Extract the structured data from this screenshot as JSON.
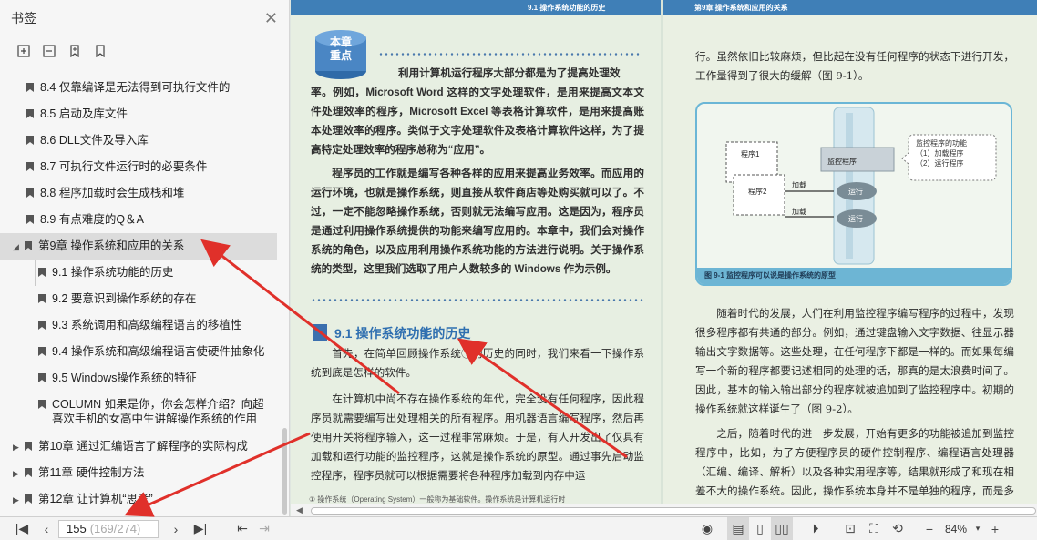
{
  "sidebar": {
    "title": "书签",
    "close": "✕",
    "items": [
      {
        "label": "8.4  仅靠编译是无法得到可执行文件的"
      },
      {
        "label": "8.5  启动及库文件"
      },
      {
        "label": "8.6  DLL文件及导入库"
      },
      {
        "label": "8.7  可执行文件运行时的必要条件"
      },
      {
        "label": "8.8  程序加载时会生成栈和堆"
      },
      {
        "label": "8.9  有点难度的Q＆A"
      },
      {
        "label": "第9章  操作系统和应用的关系"
      },
      {
        "label": "9.1  操作系统功能的历史"
      },
      {
        "label": "9.2  要意识到操作系统的存在"
      },
      {
        "label": "9.3  系统调用和高级编程语言的移植性"
      },
      {
        "label": "9.4  操作系统和高级编程语言使硬件抽象化"
      },
      {
        "label": "9.5  Windows操作系统的特征"
      },
      {
        "label": "COLUMN  如果是你，你会怎样介绍？向超喜欢手机的女高中生讲解操作系统的作用"
      },
      {
        "label": "第10章  通过汇编语言了解程序的实际构成"
      },
      {
        "label": "第11章  硬件控制方法"
      },
      {
        "label": "第12章  让计算机“思考”"
      }
    ]
  },
  "left_page": {
    "header": "9.1  操作系统功能的历史",
    "badge": "本章\n重点",
    "intro1_lead": "利用计算机运行程序大部分都是为了提高处理效",
    "intro1": "率。例如，Microsoft Word 这样的文字处理软件，是用来提高文本文件处理效率的程序，Microsoft Excel 等表格计算软件，是用来提高账本处理效率的程序。类似于文字处理软件及表格计算软件这样，为了提高特定处理效率的程序总称为“应用”。",
    "intro2": "程序员的工作就是编写各种各样的应用来提高业务效率。而应用的运行环境，也就是操作系统，则直接从软件商店等处购买就可以了。不过，一定不能忽略操作系统，否则就无法编写应用。这是因为，程序员是通过利用操作系统提供的功能来编写应用的。本章中，我们会对操作系统的角色，以及应用利用操作系统功能的方法进行说明。关于操作系统的类型，这里我们选取了用户人数较多的 Windows 作为示例。",
    "section": "9.1   操作系统功能的历史",
    "body1": "首先，在简单回顾操作系统①的历史的同时，我们来看一下操作系统到底是怎样的软件。",
    "body2": "在计算机中尚不存在操作系统的年代，完全没有任何程序，因此程序员就需要编写出处理相关的所有程序。用机器语言编写程序，然后再使用开关将程序输入，这一过程非常麻烦。于是，有人开发出了仅具有加载和运行功能的监控程序，这就是操作系统的原型。通过事先启动监控程序，程序员就可以根据需要将各种程序加载到内存中运",
    "footnote": "①  操作系统（Operating System）一般称为基础软件。操作系统是计算机运行时"
  },
  "right_page": {
    "header": "第9章  操作系统和应用的关系",
    "para1": "行。虽然依旧比较麻烦，但比起在没有任何程序的状态下进行开发，工作量得到了很大的缓解（图 9-1）。",
    "figure": {
      "prog1": "程序1",
      "prog2": "程序2",
      "monitor": "监控程序",
      "load1": "加载",
      "load2": "加载",
      "run1": "运行",
      "run2": "运行",
      "callout_title": "监控程序的功能",
      "callout_l1": "（1）加载程序",
      "callout_l2": "（2）运行程序",
      "caption": "图 9-1   监控程序可以说是操作系统的原型"
    },
    "para2": "随着时代的发展，人们在利用监控程序编写程序的过程中，发现很多程序都有共通的部分。例如，通过键盘输入文字数据、往显示器输出文字数据等。这些处理，在任何程序下都是一样的。而如果每编写一个新的程序都要记述相同的处理的话，那真的是太浪费时间了。因此，基本的输入输出部分的程序就被追加到了监控程序中。初期的操作系统就这样诞生了（图 9-2）。",
    "para3": "之后，随着时代的进一步发展，开始有更多的功能被追加到监控程序中，比如，为了方便程序员的硬件控制程序、编程语言处理器（汇编、编译、解析）以及各种实用程序等，结果就形成了和现在相差不大的操作系统。因此，操作系统本身并不是单独的程序，而是多个程序"
  },
  "toolbar": {
    "page_current": "155",
    "page_total": "(169/274)",
    "zoom": "84%"
  },
  "colors": {
    "annotation_arrow": "#e0302a",
    "header_band": "#3f7fb7",
    "section_blue": "#2f6fb0"
  }
}
